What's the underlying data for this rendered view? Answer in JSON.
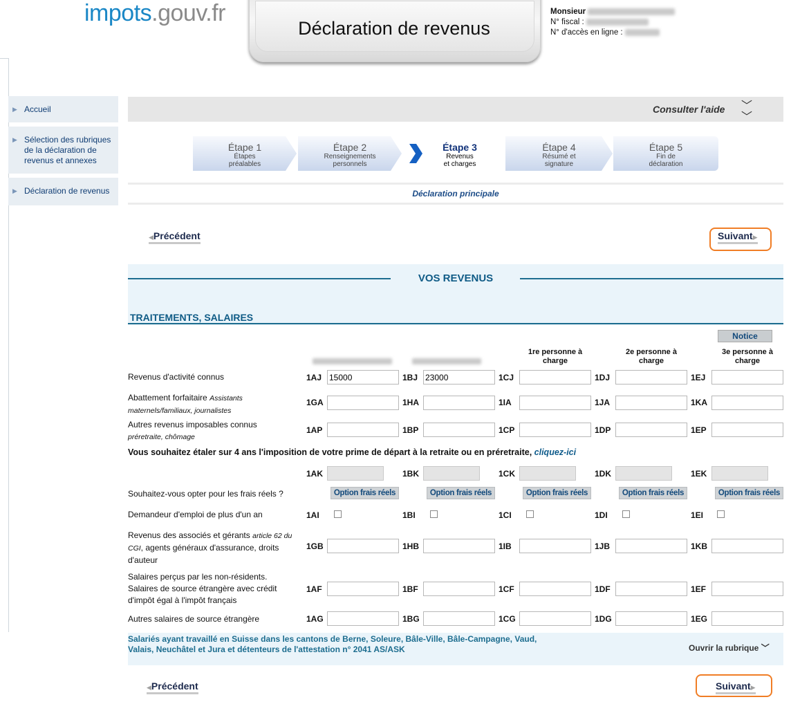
{
  "header": {
    "logo_part1": "impots",
    "logo_part2": ".gouv.fr",
    "title": "Déclaration de revenus",
    "user_label": "Monsieur",
    "fiscal_label": "N° fiscal :",
    "access_label": "N° d'accès en ligne :"
  },
  "sidebar": {
    "items": [
      {
        "label": "Accueil"
      },
      {
        "label": "Sélection des rubriques de la déclaration de revenus et annexes"
      },
      {
        "label": "Déclaration de revenus"
      }
    ]
  },
  "help": {
    "label": "Consulter l'aide"
  },
  "steps": [
    {
      "title": "Étape 1",
      "sub": "Étapes préalables"
    },
    {
      "title": "Étape 2",
      "sub": "Renseignements personnels"
    },
    {
      "title": "Étape 3",
      "sub": "Revenus et charges"
    },
    {
      "title": "Étape 4",
      "sub": "Résumé et signature"
    },
    {
      "title": "Étape 5",
      "sub": "Fin de déclaration"
    }
  ],
  "declaration_label": "Déclaration principale",
  "nav": {
    "prev": "Précédent",
    "next": "Suivant"
  },
  "section": {
    "title": "VOS REVENUS",
    "subtitle": "TRAITEMENTS, SALAIRES",
    "notice": "Notice"
  },
  "columns": {
    "p1": "1re personne à charge",
    "p2": "2e personne à charge",
    "p3": "3e personne à charge"
  },
  "rows": {
    "r1": {
      "label": "Revenus d'activité connus",
      "codes": [
        "1AJ",
        "1BJ",
        "1CJ",
        "1DJ",
        "1EJ"
      ],
      "values": [
        "15000",
        "23000",
        "",
        "",
        ""
      ]
    },
    "r2": {
      "label": "Abattement forfaitaire",
      "note": "Assistants maternels/familiaux, journalistes",
      "codes": [
        "1GA",
        "1HA",
        "1IA",
        "1JA",
        "1KA"
      ]
    },
    "r3": {
      "label": "Autres revenus imposables connus",
      "note": "préretraite, chômage",
      "codes": [
        "1AP",
        "1BP",
        "1CP",
        "1DP",
        "1EP"
      ]
    },
    "r4": {
      "codes": [
        "1AK",
        "1BK",
        "1CK",
        "1DK",
        "1EK"
      ]
    },
    "r5": {
      "label": "Souhaitez-vous opter pour les frais réels ?",
      "button": "Option frais réels"
    },
    "r6": {
      "label": "Demandeur d'emploi de plus d'un an",
      "codes": [
        "1AI",
        "1BI",
        "1CI",
        "1DI",
        "1EI"
      ]
    },
    "r7": {
      "label_a": "Revenus des associés et gérants",
      "note": "article 62 du CGI",
      "label_b": ", agents généraux d'assurance, droits d'auteur",
      "codes": [
        "1GB",
        "1HB",
        "1IB",
        "1JB",
        "1KB"
      ]
    },
    "r8": {
      "label": "Salaires perçus par les non-résidents. Salaires de source étrangère avec crédit d'impôt égal à l'impôt français",
      "codes": [
        "1AF",
        "1BF",
        "1CF",
        "1DF",
        "1EF"
      ]
    },
    "r9": {
      "label": "Autres salaires de source étrangère",
      "codes": [
        "1AG",
        "1BG",
        "1CG",
        "1DG",
        "1EG"
      ]
    }
  },
  "etaler": {
    "text": "Vous souhaitez étaler sur 4 ans l'imposition de votre prime de départ à la retraite ou en préretraite,",
    "link": "cliquez-ici"
  },
  "suisse": {
    "text": "Salariés ayant travaillé en Suisse dans les cantons de Berne, Soleure, Bâle-Ville, Bâle-Campagne, Vaud, Valais, Neuchâtel et Jura et détenteurs de l'attestation n° 2041 AS/ASK",
    "open": "Ouvrir la rubrique"
  }
}
